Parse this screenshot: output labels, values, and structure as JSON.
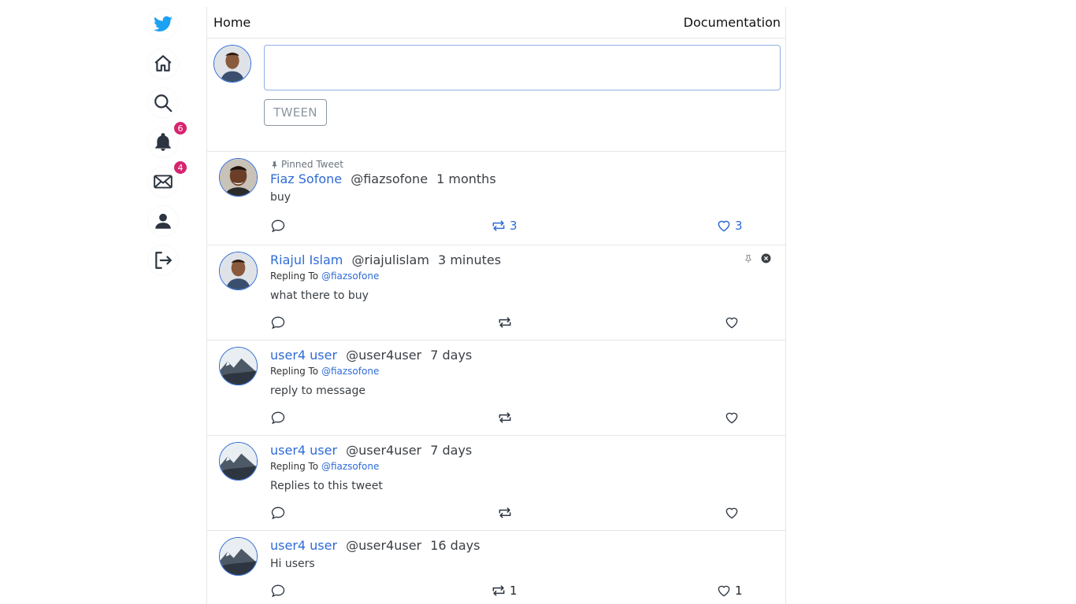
{
  "sidebar": {
    "items": [
      {
        "icon": "twitter-bird-icon"
      },
      {
        "icon": "home-icon"
      },
      {
        "icon": "search-icon"
      },
      {
        "icon": "bell-icon",
        "badge": "6"
      },
      {
        "icon": "envelope-icon",
        "badge": "4"
      },
      {
        "icon": "user-icon"
      },
      {
        "icon": "logout-icon"
      }
    ],
    "accent": "#1da1f2",
    "badge_color": "#d6246e"
  },
  "header": {
    "title": "Home",
    "link": "Documentation"
  },
  "compose": {
    "placeholder": "",
    "button_label": "TWEEN"
  },
  "colors": {
    "link": "#2e6bd6",
    "border": "#e6e6e6"
  },
  "tweets": [
    {
      "pinned_label": "Pinned Tweet",
      "name": "Fiaz Sofone",
      "handle": "@fiazsofone",
      "time": "1 months",
      "replying_prefix": "",
      "replying_to": "",
      "text": "buy",
      "retweets": "3",
      "likes": "3"
    },
    {
      "pinned_label": "",
      "name": "Riajul Islam",
      "handle": "@riajulislam",
      "time": "3 minutes",
      "replying_prefix": "Repling To",
      "replying_to": "@fiazsofone",
      "text": "what there to buy",
      "retweets": "",
      "likes": ""
    },
    {
      "pinned_label": "",
      "name": "user4 user",
      "handle": "@user4user",
      "time": "7 days",
      "replying_prefix": "Repling To",
      "replying_to": "@fiazsofone",
      "text": "reply to message",
      "retweets": "",
      "likes": ""
    },
    {
      "pinned_label": "",
      "name": "user4 user",
      "handle": "@user4user",
      "time": "7 days",
      "replying_prefix": "Repling To",
      "replying_to": "@fiazsofone",
      "text": "Replies to this tweet",
      "retweets": "",
      "likes": ""
    },
    {
      "pinned_label": "",
      "name": "user4 user",
      "handle": "@user4user",
      "time": "16 days",
      "replying_prefix": "",
      "replying_to": "",
      "text": "Hi users",
      "retweets": "1",
      "likes": "1"
    }
  ]
}
